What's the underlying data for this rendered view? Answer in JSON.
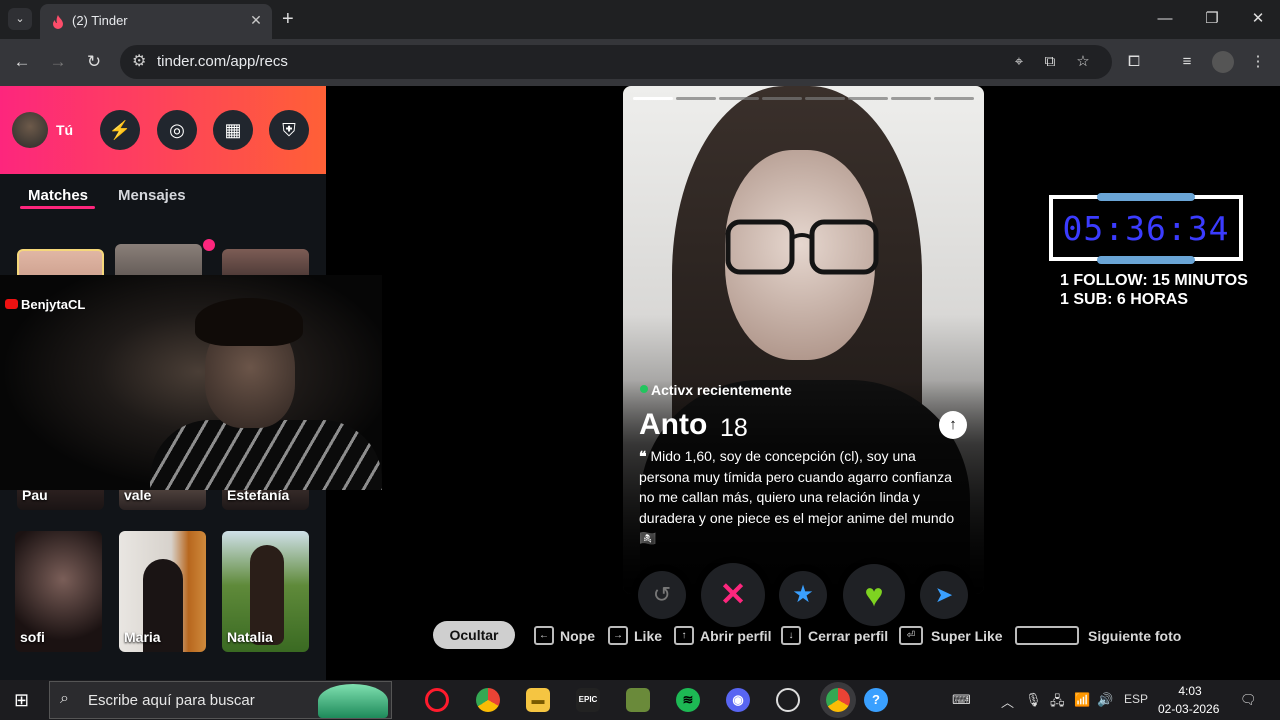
{
  "browser": {
    "tab_title": "(2) Tinder",
    "url": "tinder.com/app/recs"
  },
  "sidebar": {
    "user_label": "Tú",
    "tabs": [
      "Matches",
      "Mensajes"
    ],
    "matches": [
      "Pau",
      "vale",
      "Estefanía",
      "sofi",
      "Maria",
      "Natalia"
    ]
  },
  "stream_overlay": {
    "channel": "BenjytaCL",
    "timer": "05:36:34",
    "rule_1": "1 FOLLOW: 15 MINUTOS",
    "rule_2": "1 SUB: 6 HORAS"
  },
  "profile": {
    "status": "Activx recientemente",
    "name": "Anto",
    "age": "18",
    "bio": "Mido 1,60, soy de concepción (cl), soy una persona muy tímida pero cuando agarro confianza no me callan más, quiero una relación linda y duradera y one piece es el mejor anime del mundo 🏴‍☠️"
  },
  "shortcuts": {
    "hide": "Ocultar",
    "nope": "Nope",
    "like": "Like",
    "open": "Abrir perfil",
    "close": "Cerrar perfil",
    "superlike": "Super Like",
    "next": "Siguiente foto"
  },
  "taskbar": {
    "search_placeholder": "Escribe aquí para buscar",
    "lang": "ESP",
    "time": "4:03",
    "date": "02-03-2026"
  },
  "colors": {
    "brand": "#fd267d",
    "brand2": "#ff6036",
    "timer": "#3b3cff"
  }
}
